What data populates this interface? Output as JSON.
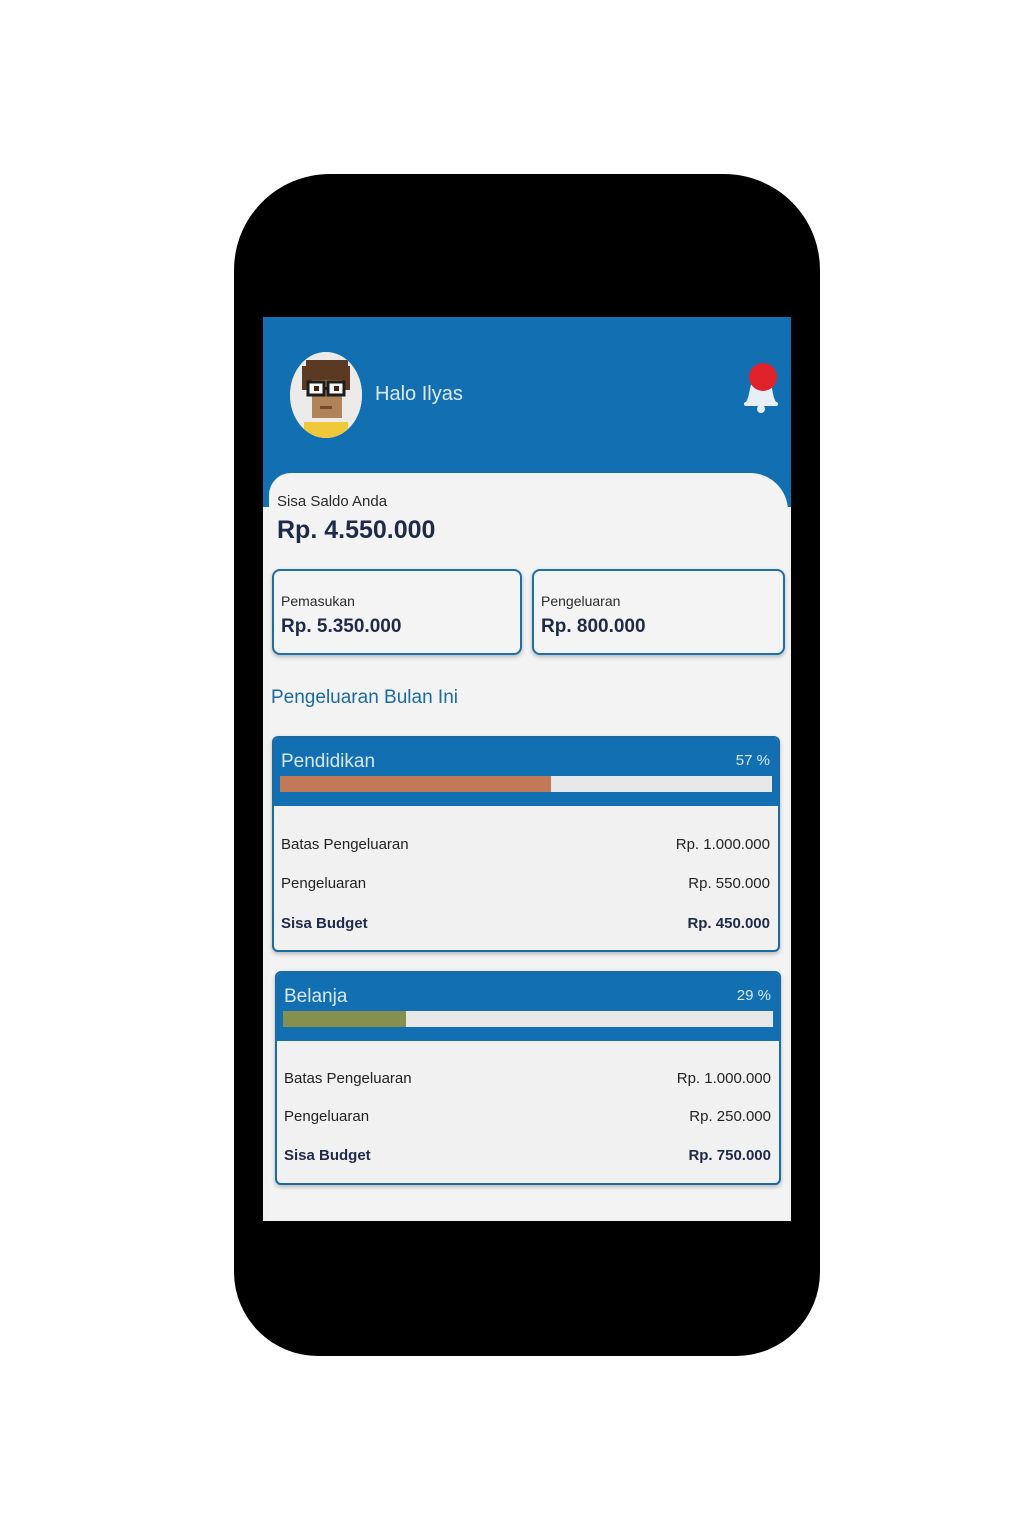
{
  "header": {
    "greeting": "Halo Ilyas",
    "bell_icon": "bell-icon",
    "avatar_icon": "avatar-icon"
  },
  "balance": {
    "label": "Sisa Saldo Anda",
    "value": "Rp. 4.550.000"
  },
  "summary": {
    "income_label": "Pemasukan",
    "income_value": "Rp. 5.350.000",
    "expense_label": "Pengeluaran",
    "expense_value": "Rp. 800.000"
  },
  "section_title": "Pengeluaran Bulan Ini",
  "budgets": [
    {
      "name": "Pendidikan",
      "percent_text": "57 %",
      "progress": 0.55,
      "bar_color": "#c07a58",
      "limit_label": "Batas Pengeluaran",
      "limit_value": "Rp. 1.000.000",
      "spent_label": "Pengeluaran",
      "spent_value": "Rp. 550.000",
      "remaining_label": "Sisa Budget",
      "remaining_value": "Rp. 450.000"
    },
    {
      "name": "Belanja",
      "percent_text": "29 %",
      "progress": 0.25,
      "bar_color": "#86904e",
      "limit_label": "Batas Pengeluaran",
      "limit_value": "Rp. 1.000.000",
      "spent_label": "Pengeluaran",
      "spent_value": "Rp. 250.000",
      "remaining_label": "Sisa Budget",
      "remaining_value": "Rp. 750.000"
    }
  ],
  "colors": {
    "primary": "#1270b2",
    "notification": "#e0222b"
  }
}
